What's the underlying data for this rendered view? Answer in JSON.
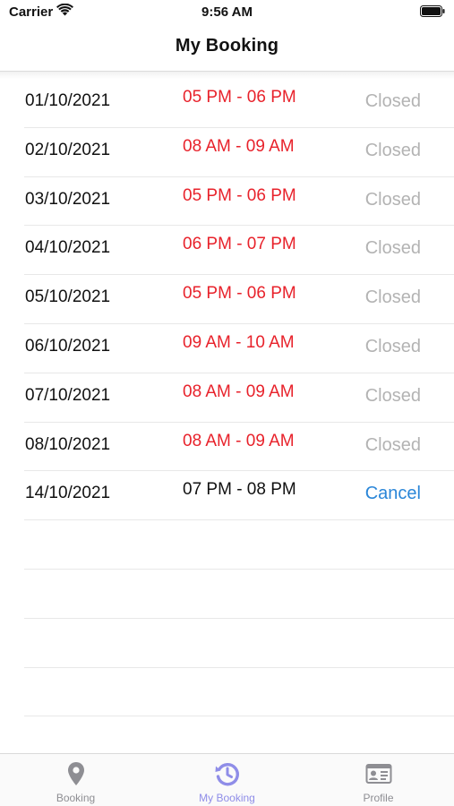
{
  "status_bar": {
    "carrier": "Carrier",
    "time": "9:56 AM"
  },
  "nav": {
    "title": "My Booking"
  },
  "bookings": [
    {
      "date": "01/10/2021",
      "time": "05 PM - 06 PM",
      "status": "Closed"
    },
    {
      "date": "02/10/2021",
      "time": "08 AM - 09 AM",
      "status": "Closed"
    },
    {
      "date": "03/10/2021",
      "time": "05 PM - 06 PM",
      "status": "Closed"
    },
    {
      "date": "04/10/2021",
      "time": "06 PM - 07 PM",
      "status": "Closed"
    },
    {
      "date": "05/10/2021",
      "time": "05 PM - 06 PM",
      "status": "Closed"
    },
    {
      "date": "06/10/2021",
      "time": "09 AM - 10 AM",
      "status": "Closed"
    },
    {
      "date": "07/10/2021",
      "time": "08 AM - 09 AM",
      "status": "Closed"
    },
    {
      "date": "08/10/2021",
      "time": "08 AM - 09 AM",
      "status": "Closed"
    },
    {
      "date": "14/10/2021",
      "time": "07 PM - 08 PM",
      "status": "Cancel"
    }
  ],
  "tabs": [
    {
      "label": "Booking",
      "icon": "location-pin-icon",
      "active": false
    },
    {
      "label": "My Booking",
      "icon": "history-clock-icon",
      "active": true
    },
    {
      "label": "Profile",
      "icon": "id-card-icon",
      "active": false
    }
  ],
  "colors": {
    "closed_time": "#e8222b",
    "active_time": "#111111",
    "closed_status": "#b3b3b3",
    "cancel_action": "#2a86d8",
    "tab_active": "#8f8de8",
    "tab_inactive": "#8e8e93"
  }
}
